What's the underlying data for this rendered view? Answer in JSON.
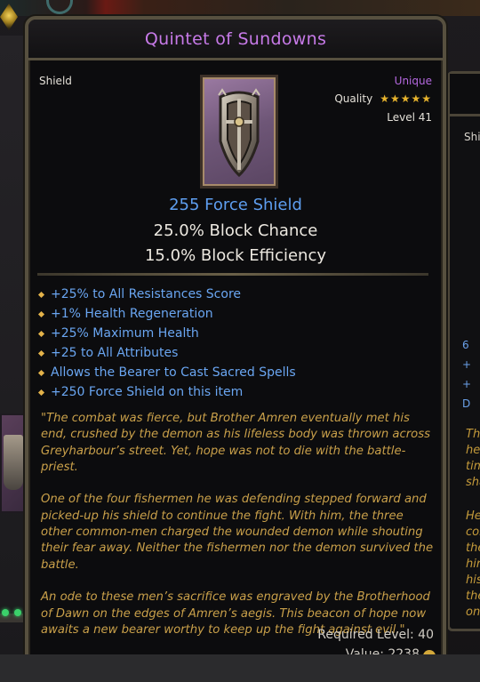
{
  "tooltip": {
    "title": "Quintet of Sundowns",
    "item_type": "Shield",
    "rarity": "Unique",
    "quality_label": "Quality",
    "quality_stars": 5,
    "level": "Level 41",
    "force_shield": "255 Force Shield",
    "block_chance": "25.0% Block Chance",
    "block_efficiency": "15.0% Block Efficiency",
    "affixes": [
      "+25% to All Resistances Score",
      "+1% Health Regeneration",
      "+25% Maximum Health",
      "+25 to All Attributes",
      "Allows the Bearer to Cast Sacred Spells",
      "+250 Force Shield on this item"
    ],
    "lore": [
      "\"The combat was fierce, but Brother Amren eventually met his end, crushed by the demon as his lifeless body was thrown across Greyharbour’s street. Yet, hope was not to die with the battle-priest.",
      "One of the four fishermen he was defending stepped forward and picked-up his shield to continue the fight. With him, the three other common-men charged the wounded demon while shouting their fear away. Neither the fishermen nor the demon survived the battle.",
      "An ode to these men’s sacrifice was engraved by the Brotherhood of Dawn on the edges of Amren’s aegis. This beacon of hope now awaits a new bearer worthy to keep up the fight against evil.\""
    ],
    "required_level": "Required Level: 40",
    "value": "Value: 2238"
  },
  "colors": {
    "title": "#c77ae8",
    "unique": "#b568e0",
    "magic_blue": "#5e9ef0",
    "lore_gold": "#c9a04a",
    "star_gold": "#e7b32d"
  },
  "background_right": {
    "label": "Shie",
    "bullets": [
      "6",
      "+",
      "+",
      "D"
    ],
    "lore_fragments": [
      "The",
      "her",
      "tim",
      "sha",
      "He",
      "cor",
      "the",
      "hin",
      "his",
      "the",
      "oni"
    ]
  }
}
